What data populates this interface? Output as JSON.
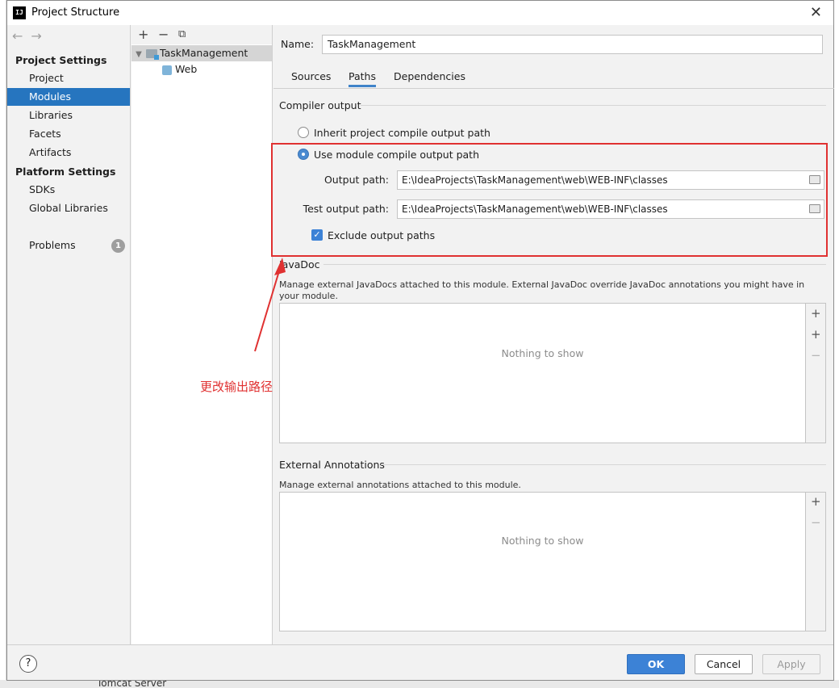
{
  "window": {
    "title": "Project Structure",
    "app_icon": "IJ"
  },
  "sidebar": {
    "project_settings_header": "Project Settings",
    "items": [
      "Project",
      "Modules",
      "Libraries",
      "Facets",
      "Artifacts"
    ],
    "platform_settings_header": "Platform Settings",
    "platform_items": [
      "SDKs",
      "Global Libraries"
    ],
    "problems_label": "Problems",
    "problems_count": "1"
  },
  "tree": {
    "module": "TaskManagement",
    "facet": "Web"
  },
  "module": {
    "name_label": "Name:",
    "name_value": "TaskManagement",
    "tabs": [
      "Sources",
      "Paths",
      "Dependencies"
    ],
    "active_tab": "Paths"
  },
  "compiler": {
    "title": "Compiler output",
    "inherit_label": "Inherit project compile output path",
    "use_module_label": "Use module compile output path",
    "output_path_label": "Output path:",
    "output_path_value": "E:\\IdeaProjects\\TaskManagement\\web\\WEB-INF\\classes",
    "test_output_path_label": "Test output path:",
    "test_output_path_value": "E:\\IdeaProjects\\TaskManagement\\web\\WEB-INF\\classes",
    "exclude_label": "Exclude output paths",
    "exclude_checked": true
  },
  "javadoc": {
    "title": "JavaDoc",
    "description": "Manage external JavaDocs attached to this module. External JavaDoc override JavaDoc annotations you might have in your module.",
    "empty_text": "Nothing to show"
  },
  "annotations": {
    "title": "External Annotations",
    "description": "Manage external annotations attached to this module.",
    "empty_text": "Nothing to show"
  },
  "footer": {
    "help": "?",
    "ok": "OK",
    "cancel": "Cancel",
    "apply": "Apply"
  },
  "annotation_note": "更改输出路径",
  "background": {
    "bottom_text": "Tomcat Server"
  },
  "colors": {
    "accent": "#2675bf",
    "highlight_box": "#e03131"
  }
}
